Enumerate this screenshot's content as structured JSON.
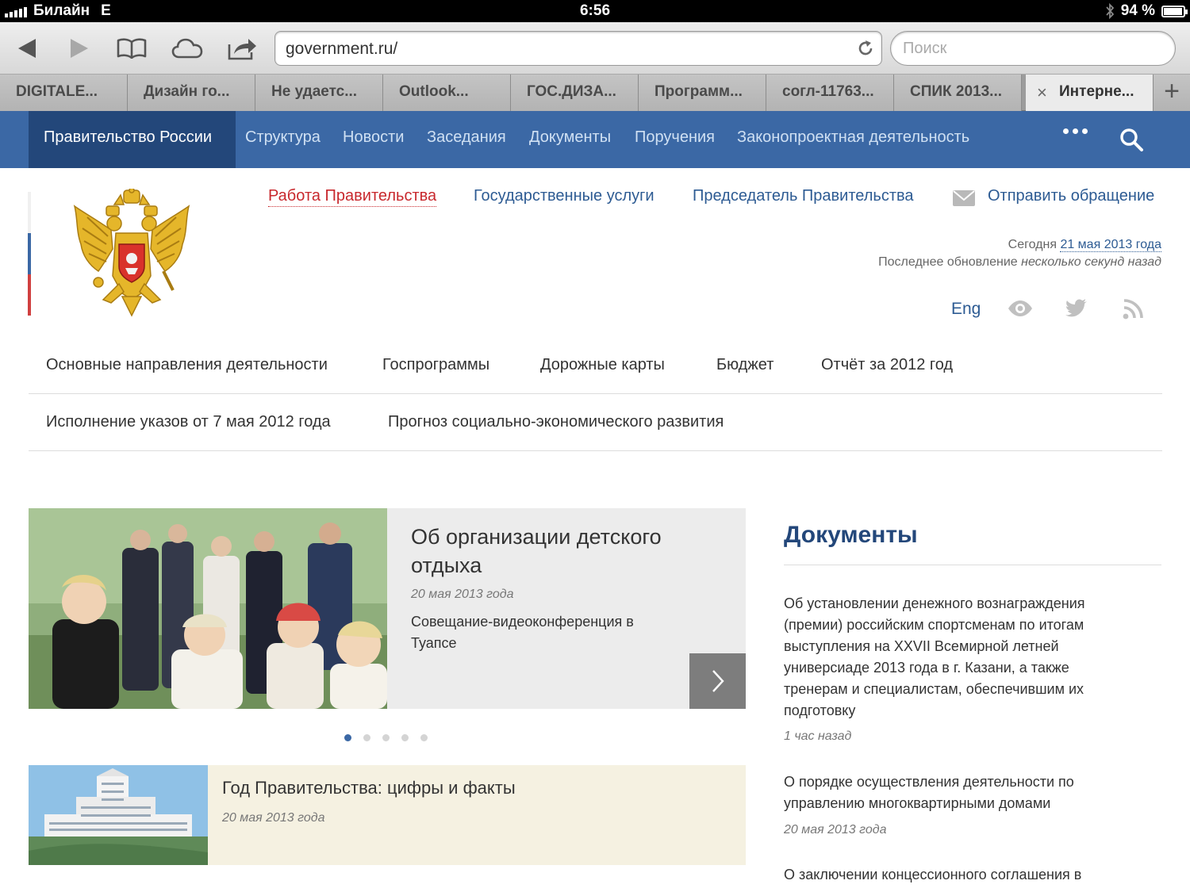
{
  "status_bar": {
    "carrier": "Билайн",
    "network": "E",
    "time": "6:56",
    "battery_percent": "94 %",
    "battery_level": 0.94
  },
  "browser": {
    "url": "government.ru/",
    "search_placeholder": "Поиск",
    "tabs": [
      {
        "label": "DIGITALE..."
      },
      {
        "label": "Дизайн го..."
      },
      {
        "label": "Не удаетс..."
      },
      {
        "label": "Outlook..."
      },
      {
        "label": "ГОС.ДИЗА..."
      },
      {
        "label": "Программ..."
      },
      {
        "label": "согл-11763..."
      },
      {
        "label": "СПИК 2013..."
      },
      {
        "label": "Интерне..."
      }
    ],
    "close_glyph": "×",
    "new_tab_glyph": "+"
  },
  "site_nav": {
    "brand": "Правительство России",
    "links": [
      "Структура",
      "Новости",
      "Заседания",
      "Документы",
      "Поручения",
      "Законопроектная деятельность"
    ]
  },
  "header": {
    "links": [
      {
        "label": "Работа Правительства"
      },
      {
        "label": "Государственные услуги"
      },
      {
        "label": "Председатель Правительства"
      },
      {
        "label": "Отправить обращение"
      }
    ],
    "today_label": "Сегодня",
    "today_date": "21 мая 2013 года",
    "update_label": "Последнее обновление",
    "update_value": "несколько секунд назад",
    "lang_link": "Eng"
  },
  "sections_menu": {
    "row1": [
      "Основные направления деятельности",
      "Госпрограммы",
      "Дорожные карты",
      "Бюджет",
      "Отчёт за 2012 год"
    ],
    "row2": [
      "Исполнение указов от 7 мая 2012 года",
      "Прогноз социально-экономического развития"
    ]
  },
  "slider": {
    "title": "Об организации детского отдыха",
    "date": "20 мая 2013 года",
    "subtitle": "Совещание-видеоконференция в Туапсе"
  },
  "news": {
    "title": "Год Правительства: цифры и факты",
    "date": "20 мая 2013 года"
  },
  "documents": {
    "heading": "Документы",
    "items": [
      {
        "text": "Об установлении денежного вознаграждения (премии) российским спортсменам по итогам выступления на XXVII Всемирной летней универсиаде 2013 года в г. Казани, а также тренерам и специалистам, обеспечившим их подготовку",
        "time": "1 час назад"
      },
      {
        "text": "О порядке осуществления деятельности по управлению многоквартирными домами",
        "time": "20 мая 2013 года"
      },
      {
        "text": "О заключении концессионного соглашения в"
      }
    ]
  },
  "colors": {
    "nav_blue": "#3b68a5",
    "nav_dark": "#23477a",
    "link_blue": "#2d5b93",
    "active_red": "#c8282d",
    "news_bg": "#f5f1e1"
  }
}
